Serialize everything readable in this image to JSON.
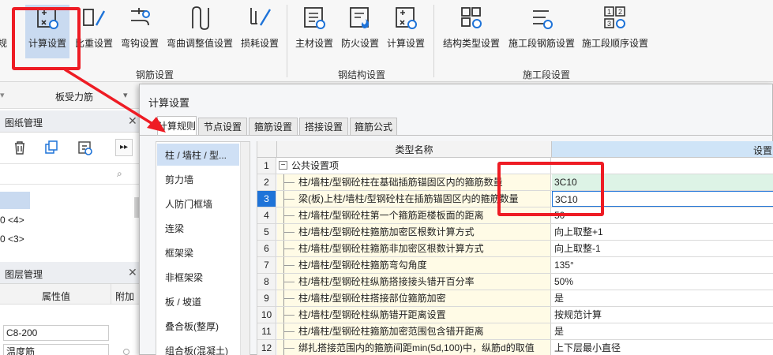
{
  "ribbon": {
    "left_partial_label": "规",
    "rebar_buttons": [
      "计算设置",
      "比重设置",
      "弯钩设置",
      "弯曲调整值设置",
      "损耗设置"
    ],
    "rebar_group": "钢筋设置",
    "steel_buttons": [
      "主材设置",
      "防火设置",
      "计算设置"
    ],
    "steel_group": "钢结构设置",
    "stage_buttons": [
      "结构类型设置",
      "施工段钢筋设置",
      "施工段顺序设置"
    ],
    "stage_group": "施工段设置"
  },
  "left": {
    "toolbar_combo": "板受力筋",
    "drawing_panel": "图纸管理",
    "drawing_items": [
      "0 <4>",
      "0 <3>"
    ],
    "layer_panel": "图层管理",
    "col_value": "属性值",
    "col_extra": "附加",
    "prop_values": [
      "C8-200",
      "温度筋"
    ]
  },
  "dialog": {
    "title": "计算设置",
    "tabs": [
      "计算规则",
      "节点设置",
      "箍筋设置",
      "搭接设置",
      "箍筋公式"
    ],
    "categories": [
      "柱 / 墙柱 / 型...",
      "剪力墙",
      "人防门框墙",
      "连梁",
      "框架梁",
      "非框架梁",
      "板 / 坡道",
      "叠合板(整厚)",
      "组合板(混凝土)"
    ],
    "grid": {
      "col_type": "类型名称",
      "col_setting": "设置",
      "rows": [
        {
          "no": "1",
          "name": "公共设置项",
          "value": ""
        },
        {
          "no": "2",
          "name": "柱/墙柱/型钢砼柱在基础插筋锚固区内的箍筋数量",
          "value": "3C10"
        },
        {
          "no": "3",
          "name": "梁(板)上柱/墙柱/型钢砼柱在插筋锚固区内的箍筋数量",
          "value": "3C10"
        },
        {
          "no": "4",
          "name": "柱/墙柱/型钢砼柱第一个箍筋距楼板面的距离",
          "value": "50"
        },
        {
          "no": "5",
          "name": "柱/墙柱/型钢砼柱箍筋加密区根数计算方式",
          "value": "向上取整+1"
        },
        {
          "no": "6",
          "name": "柱/墙柱/型钢砼柱箍筋非加密区根数计算方式",
          "value": "向上取整-1"
        },
        {
          "no": "7",
          "name": "柱/墙柱/型钢砼柱箍筋弯勾角度",
          "value": "135°"
        },
        {
          "no": "8",
          "name": "柱/墙柱/型钢砼柱纵筋搭接接头错开百分率",
          "value": "50%"
        },
        {
          "no": "9",
          "name": "柱/墙柱/型钢砼柱搭接部位箍筋加密",
          "value": "是"
        },
        {
          "no": "10",
          "name": "柱/墙柱/型钢砼柱纵筋错开距离设置",
          "value": "按规范计算"
        },
        {
          "no": "11",
          "name": "柱/墙柱/型钢砼柱箍筋加密范围包含错开距离",
          "value": "是"
        },
        {
          "no": "12",
          "name": "绑扎搭接范围内的箍筋间距min(5d,100)中，纵筋d的取值",
          "value": "上下层最小直径"
        }
      ]
    }
  },
  "colors": {
    "annotation": "#ee1c24",
    "selected_header": "#cfe4f7",
    "selected_tab_blue": "#cfe0f5"
  }
}
